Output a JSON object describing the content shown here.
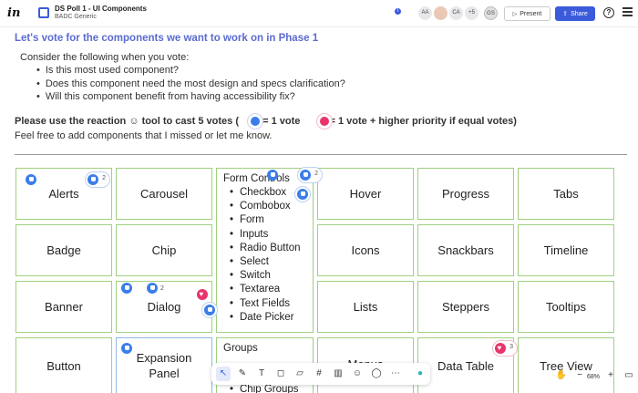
{
  "header": {
    "logo": "in",
    "title": "DS Poll 1 - UI Components",
    "subtitle": "BADC Generic",
    "avatars": [
      "AA",
      "",
      "CA",
      "+5",
      "GS"
    ],
    "present_label": "Present",
    "share_label": "Share",
    "help": "?"
  },
  "instructions": {
    "heading": "Let's vote for the components we want to work on in Phase 1",
    "intro": "Consider the following when you vote:",
    "bullets": [
      "Is this most used component?",
      "Does this component need the most design and specs clarification?",
      "Will this component benefit from having accessibility fix?"
    ],
    "reaction_pre": "Please use the reaction",
    "reaction_mid": "tool to cast 5 votes (",
    "reaction_like": "= 1 vote",
    "reaction_heart": "= 1 vote + higher priority if equal votes)",
    "feel_free": "Feel free to add components that I missed or let me know."
  },
  "cards": {
    "alerts": "Alerts",
    "carousel": "Carousel",
    "hover": "Hover",
    "progress": "Progress",
    "tabs": "Tabs",
    "badge": "Badge",
    "chip": "Chip",
    "icons": "Icons",
    "snackbars": "Snackbars",
    "timeline": "Timeline",
    "banner": "Banner",
    "dialog": "Dialog",
    "lists": "Lists",
    "steppers": "Steppers",
    "tooltips": "Tooltips",
    "button": "Button",
    "expansion_panel_1": "Expansion",
    "expansion_panel_2": "Panel",
    "menus": "Menus",
    "data_table": "Data Table",
    "tree_view": "Tree View"
  },
  "form_controls": {
    "heading": "Form Controls",
    "items": [
      "Checkbox",
      "Combobox",
      "Form",
      "Inputs",
      "Radio Button",
      "Select",
      "Switch",
      "Textarea",
      "Text Fields",
      "Date Picker"
    ]
  },
  "groups": {
    "heading": "Groups",
    "items": [
      "Chip Groups"
    ]
  },
  "reactions": {
    "carousel_count": "2",
    "form_controls_count": "2",
    "dialog_count": "2",
    "data_table_count": "3"
  },
  "zoom": {
    "level": "68%",
    "minus": "−",
    "plus": "+"
  },
  "colors": {
    "accent": "#3b5bdb",
    "heading": "#5b6bd1",
    "card_border": "#9fd07f",
    "like": "#3b7de9",
    "heart": "#e8346b"
  }
}
